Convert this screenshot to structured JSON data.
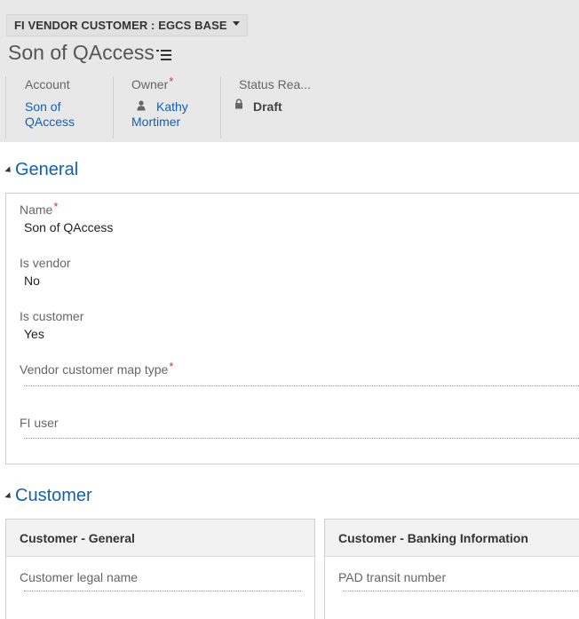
{
  "header": {
    "form_selector": "FI VENDOR CUSTOMER : EGCS BASE",
    "record_title": "Son of QAccess",
    "fields": {
      "account": {
        "label": "Account",
        "value_line1": "Son of",
        "value_line2": "QAccess"
      },
      "owner": {
        "label": "Owner",
        "required_mark": "*",
        "value_line1": "Kathy",
        "value_line2": "Mortimer"
      },
      "status_reason": {
        "label": "Status Rea...",
        "value": "Draft"
      }
    }
  },
  "general": {
    "title": "General",
    "fields": {
      "name": {
        "label": "Name",
        "required_mark": "*",
        "value": "Son of QAccess"
      },
      "is_vendor": {
        "label": "Is vendor",
        "value": "No"
      },
      "is_customer": {
        "label": "Is customer",
        "value": "Yes"
      },
      "map_type": {
        "label": "Vendor customer map type",
        "required_mark": "*",
        "value": ""
      },
      "fi_user": {
        "label": "FI user",
        "value": ""
      }
    }
  },
  "customer": {
    "title": "Customer",
    "panels": {
      "general": {
        "title": "Customer - General",
        "field_label": "Customer legal name"
      },
      "banking": {
        "title": "Customer - Banking Information",
        "field_label": "PAD transit number"
      }
    }
  },
  "icons": {
    "form_selector_caret": "caret-down-icon",
    "nav_menu": "list-menu-icon",
    "owner_user": "user-icon",
    "status_lock": "lock-icon",
    "section_toggle": "collapse-triangle-icon"
  },
  "colors": {
    "header_bg": "#e8e8e8",
    "link": "#1160b7",
    "required": "#c0392b",
    "panel_header_bg": "#f2f2f2"
  }
}
